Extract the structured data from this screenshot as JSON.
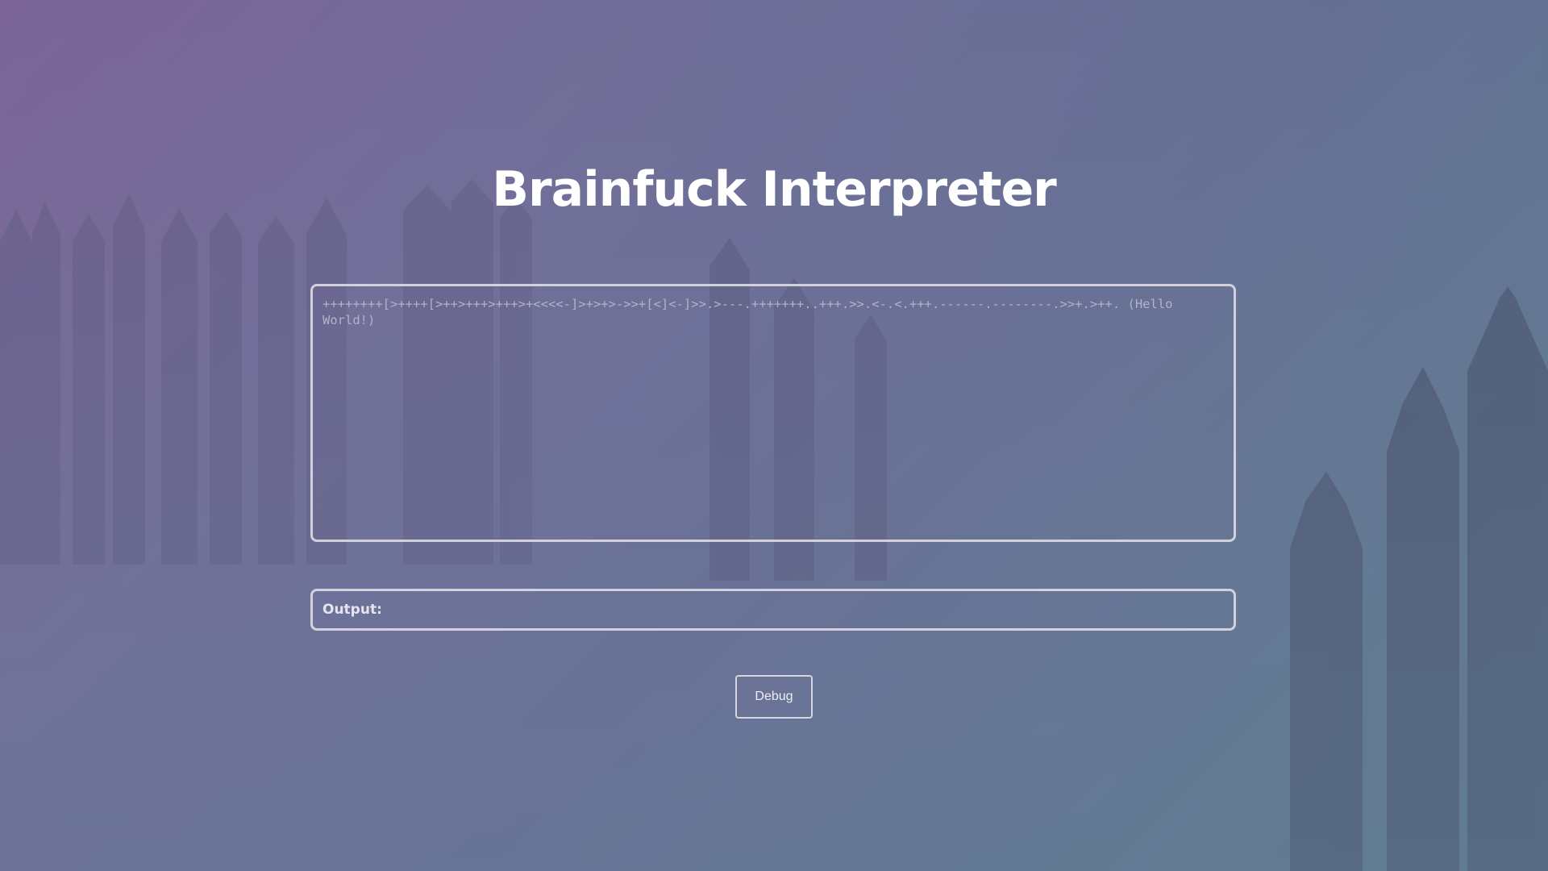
{
  "page": {
    "title": "Brainfuck Interpreter"
  },
  "editor": {
    "placeholder": "++++++++[>++++[>++>+++>+++>+<<<<-]>+>+>->>+[<]<-]>>.>---.+++++++..+++.>>.<-.<.+++.------.--------.>>+.>++. (Hello World!)"
  },
  "output": {
    "label": "Output:",
    "value": ""
  },
  "controls": {
    "debug_label": "Debug"
  },
  "colors": {
    "background_top_left": "#7b6498",
    "background_bottom_right": "#5a7d8e",
    "border": "#d2d0dc",
    "title": "#ffffff",
    "placeholder_text": "#b4b2c8"
  },
  "icons": {
    "background": "misty-forest-background"
  }
}
